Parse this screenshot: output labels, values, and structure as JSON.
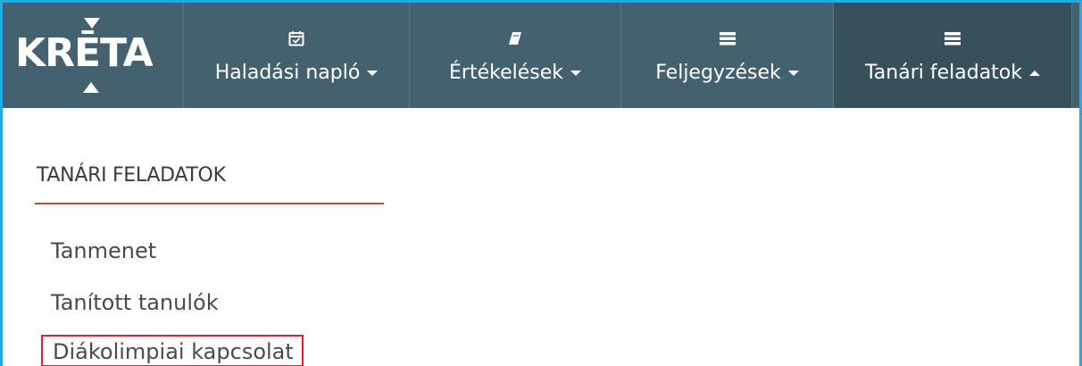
{
  "brand": {
    "logo_text": "KRĒTA",
    "colors": {
      "navbar": "#44616f",
      "navbar_active": "#37505c",
      "frame": "#29a8df",
      "highlight": "#d9232f",
      "rule": "#c8454a"
    }
  },
  "nav": {
    "items": [
      {
        "label": "Haladási napló",
        "icon": "calendar-check-icon",
        "caret": "down"
      },
      {
        "label": "Értékelések",
        "icon": "book-icon",
        "caret": "down"
      },
      {
        "label": "Feljegyzések",
        "icon": "list-icon",
        "caret": "down"
      },
      {
        "label": "Tanári feladatok",
        "icon": "list-icon",
        "caret": "up",
        "active": true
      }
    ]
  },
  "section": {
    "title": "TANÁRI FELADATOK",
    "items": [
      {
        "label": "Tanmenet"
      },
      {
        "label": "Tanított tanulók"
      },
      {
        "label": "Diákolimpiai kapcsolat",
        "highlighted": true
      }
    ]
  }
}
